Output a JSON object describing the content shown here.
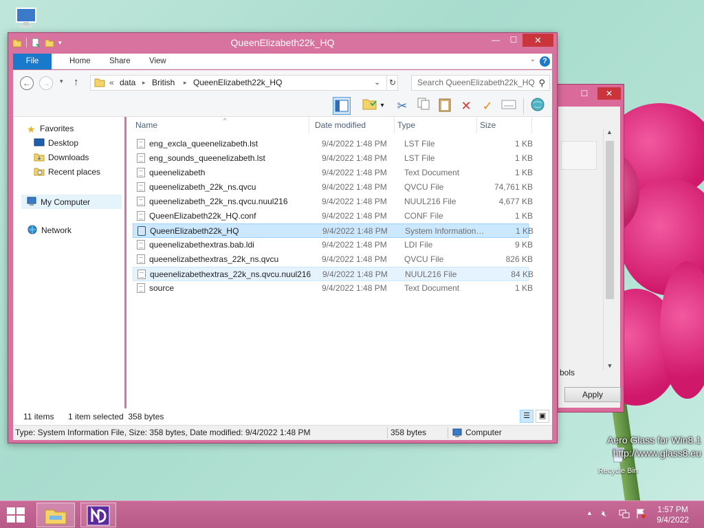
{
  "window": {
    "title": "QueenElizabeth22k_HQ",
    "minimize": "—",
    "maximize": "☐",
    "close": "✕"
  },
  "ribbon": {
    "tabs": [
      "File",
      "Home",
      "Share",
      "View"
    ],
    "help": "?"
  },
  "address": {
    "overflow": "«",
    "crumbs": [
      "data",
      "British",
      "QueenElizabeth22k_HQ"
    ],
    "search_placeholder": "Search QueenElizabeth22k_HQ"
  },
  "nav": {
    "favorites": "Favorites",
    "desktop": "Desktop",
    "downloads": "Downloads",
    "recent": "Recent places",
    "computer": "My Computer",
    "network": "Network"
  },
  "columns": {
    "name": "Name",
    "date": "Date modified",
    "type": "Type",
    "size": "Size"
  },
  "files": [
    {
      "name": "eng_excla_queenelizabeth.lst",
      "date": "9/4/2022 1:48 PM",
      "type": "LST File",
      "size": "1 KB",
      "icon": "doc"
    },
    {
      "name": "eng_sounds_queenelizabeth.lst",
      "date": "9/4/2022 1:48 PM",
      "type": "LST File",
      "size": "1 KB",
      "icon": "doc"
    },
    {
      "name": "queenelizabeth",
      "date": "9/4/2022 1:48 PM",
      "type": "Text Document",
      "size": "1 KB",
      "icon": "doc"
    },
    {
      "name": "queenelizabeth_22k_ns.qvcu",
      "date": "9/4/2022 1:48 PM",
      "type": "QVCU File",
      "size": "74,761 KB",
      "icon": "doc"
    },
    {
      "name": "queenelizabeth_22k_ns.qvcu.nuul216",
      "date": "9/4/2022 1:48 PM",
      "type": "NUUL216 File",
      "size": "4,677 KB",
      "icon": "doc"
    },
    {
      "name": "QueenElizabeth22k_HQ.conf",
      "date": "9/4/2022 1:48 PM",
      "type": "CONF File",
      "size": "1 KB",
      "icon": "doc"
    },
    {
      "name": "QueenElizabeth22k_HQ",
      "date": "9/4/2022 1:48 PM",
      "type": "System Information File",
      "size": "1 KB",
      "icon": "sys"
    },
    {
      "name": "queenelizabethextras.bab.ldi",
      "date": "9/4/2022 1:48 PM",
      "type": "LDI File",
      "size": "9 KB",
      "icon": "doc"
    },
    {
      "name": "queenelizabethextras_22k_ns.qvcu",
      "date": "9/4/2022 1:48 PM",
      "type": "QVCU File",
      "size": "826 KB",
      "icon": "doc"
    },
    {
      "name": "queenelizabethextras_22k_ns.qvcu.nuul216",
      "date": "9/4/2022 1:48 PM",
      "type": "NUUL216 File",
      "size": "84 KB",
      "icon": "doc"
    },
    {
      "name": "source",
      "date": "9/4/2022 1:48 PM",
      "type": "Text Document",
      "size": "1 KB",
      "icon": "doc"
    }
  ],
  "status": {
    "count": "11 items",
    "selected": "1 item selected  358 bytes",
    "detail": "Type: System Information File, Size: 358 bytes, Date modified: 9/4/2022 1:48 PM",
    "bytes": "358 bytes",
    "location": "Computer"
  },
  "bgwindow": {
    "apply": "Apply",
    "partial_text": "bols"
  },
  "desktop": {
    "watermark_line1": "Aero Glass for Win8.1",
    "watermark_line2": "http://www.glass8.eu",
    "recycle_bin": "Recycle Bin"
  },
  "taskbar": {
    "time": "1:57 PM",
    "date": "9/4/2022"
  },
  "colors": {
    "accent": "#1979ca",
    "frame": "#d8739f",
    "selection": "#cce8ff"
  }
}
